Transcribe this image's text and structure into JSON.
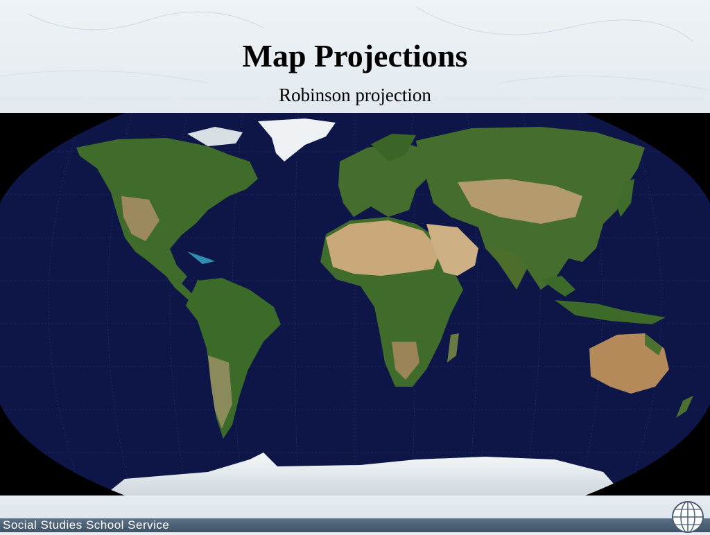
{
  "slide": {
    "title": "Map Projections",
    "subtitle": "Robinson projection"
  },
  "map": {
    "projection": "Robinson",
    "ocean_color": "#0d1646",
    "land_color": "#3d6b2a",
    "desert_color": "#c9a97a",
    "ice_color": "#eef2f4"
  },
  "footer": {
    "publisher": "Social Studies School Service",
    "logo_icon": "globe-icon"
  }
}
